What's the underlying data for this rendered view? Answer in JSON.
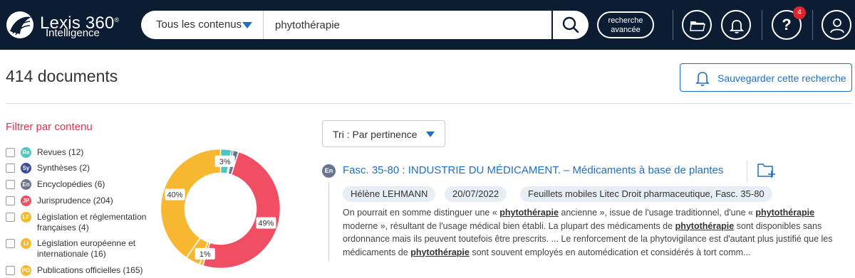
{
  "brand": {
    "name": "Lexis 360",
    "trademark": "®",
    "sub": "Intelligence"
  },
  "search": {
    "scope_label": "Tous les contenus",
    "query": "phytothérapie",
    "advanced_line1": "recherche",
    "advanced_line2": "avancée"
  },
  "header": {
    "notifications_count": "4",
    "help_label": "?"
  },
  "results_header": {
    "count_label": "414 documents",
    "save_search_label": "Sauvegarder cette recherche"
  },
  "filter": {
    "title": "Filtrer par contenu",
    "items": [
      {
        "abbr": "Re",
        "label": "Revues (12)",
        "color": "#4dc5c0"
      },
      {
        "abbr": "Sy",
        "label": "Synthèses (2)",
        "color": "#3b4d9a"
      },
      {
        "abbr": "En",
        "label": "Encyclopédies (6)",
        "color": "#6a7390"
      },
      {
        "abbr": "JP",
        "label": "Jurisprudence (204)",
        "color": "#f04e63"
      },
      {
        "abbr": "LF",
        "label_line1": "Législation et réglementation",
        "label_line2": "françaises (4)",
        "color": "#f7b731"
      },
      {
        "abbr": "LI",
        "label_line1": "Législation européenne et",
        "label_line2": "internationale (16)",
        "color": "#f7b731"
      },
      {
        "abbr": "PO",
        "label": "Publications officielles (165)",
        "color": "#f7b731"
      }
    ]
  },
  "chart_data": {
    "type": "pie",
    "donut": true,
    "slices": [
      {
        "name": "Revues",
        "value": 12,
        "color": "#4dc5c0",
        "label": "3%"
      },
      {
        "name": "Synthèses",
        "value": 2,
        "color": "#3b4d9a",
        "label": ""
      },
      {
        "name": "Encyclopédies",
        "value": 6,
        "color": "#6a7390",
        "label": ""
      },
      {
        "name": "Jurisprudence",
        "value": 204,
        "color": "#f04e63",
        "label": "49%"
      },
      {
        "name": "Législation et réglementation françaises",
        "value": 4,
        "color": "#f7b731",
        "label": "1%"
      },
      {
        "name": "Législation européenne et internationale",
        "value": 16,
        "color": "#f7b731",
        "label": ""
      },
      {
        "name": "Publications officielles",
        "value": 165,
        "color": "#f7b731",
        "label": "40%"
      }
    ]
  },
  "sort": {
    "label": "Tri : Par pertinence"
  },
  "result": {
    "type_abbr": "En",
    "title": "Fasc. 35-80 : INDUSTRIE DU MÉDICAMENT. – Médicaments à base de plantes",
    "author": "Hélène LEHMANN",
    "date": "20/07/2022",
    "source": "Feuillets mobiles Litec Droit pharmaceutique, Fasc. 35-80",
    "snippet": [
      {
        "t": "On pourrait en somme distinguer une « "
      },
      {
        "t": "phytothérapie",
        "hl": true
      },
      {
        "t": " ancienne », issue de l'usage traditionnel, d'une « "
      },
      {
        "t": "phytothérapie",
        "hl": true
      },
      {
        "t": " moderne », résultant de l'usage médical bien établi. La plupart des médicaments de "
      },
      {
        "t": "phytothérapie",
        "hl": true
      },
      {
        "t": " sont disponibles sans ordonnance mais ils peuvent toutefois être prescrits. ... Le renforcement de la phytovigilance est d'autant plus justifié que les médicaments de "
      },
      {
        "t": "phytothérapie",
        "hl": true
      },
      {
        "t": " sont souvent employés en automédication et considérés à tort comm..."
      }
    ]
  }
}
